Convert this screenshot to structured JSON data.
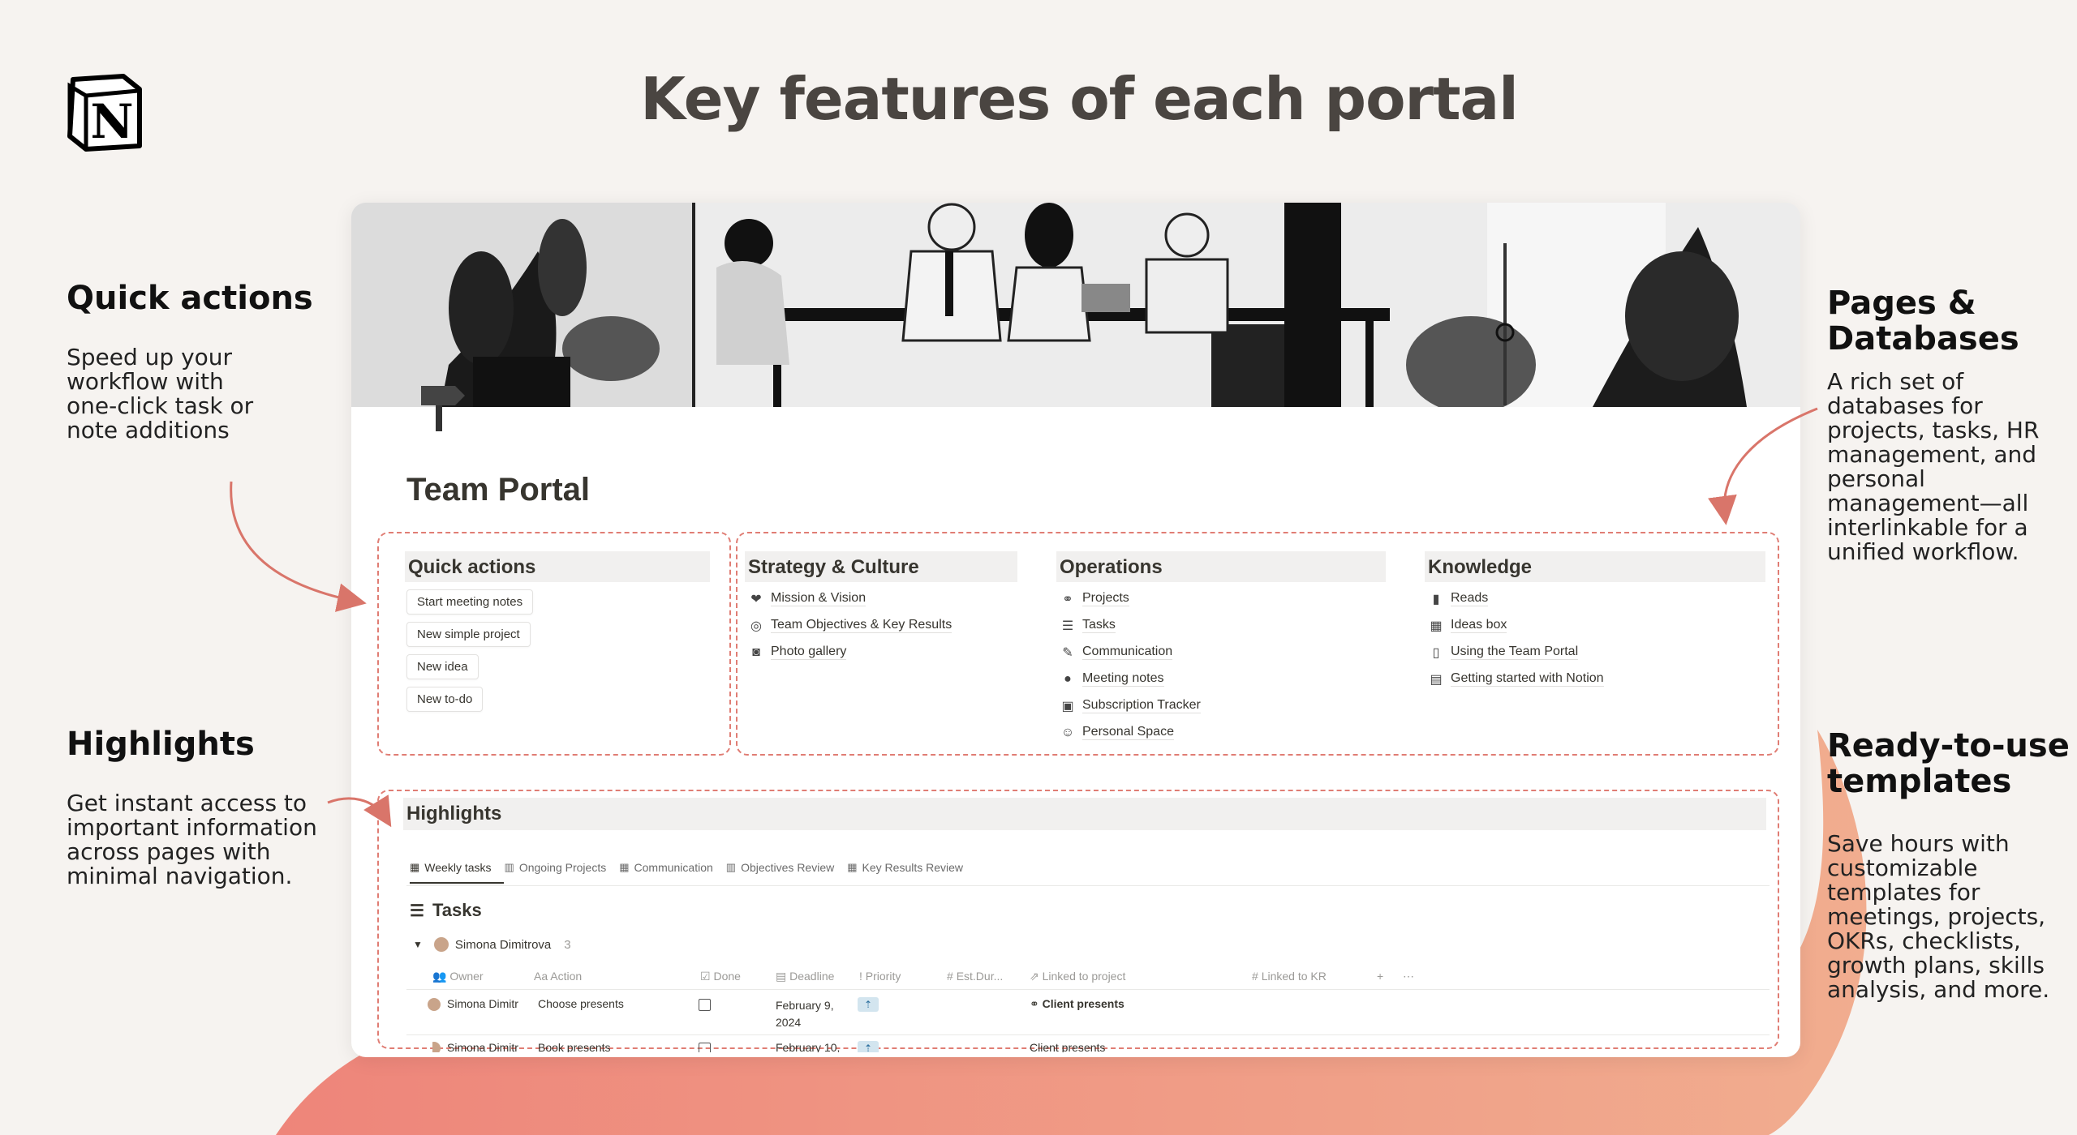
{
  "title": "Key features of each portal",
  "left": {
    "quick_actions": {
      "heading": "Quick actions",
      "text": [
        "Speed up your",
        "workflow with",
        "one-click task or",
        "note additions"
      ]
    },
    "highlights": {
      "heading": "Highlights",
      "text": [
        "Get instant access to",
        "important information",
        "across pages with",
        "minimal navigation."
      ]
    }
  },
  "right": {
    "pages": {
      "heading": [
        "Pages &",
        "Databases"
      ],
      "text": [
        "A rich set of",
        "databases for",
        "projects, tasks, HR",
        "management, and",
        "personal",
        "management—all",
        "interlinkable for a",
        "unified workflow."
      ]
    },
    "templates": {
      "heading": [
        "Ready-to-use",
        "templates"
      ],
      "text": [
        "Save hours with",
        "customizable",
        "templates for",
        "meetings, projects,",
        "OKRs, checklists,",
        "growth plans, skills",
        "analysis, and more."
      ]
    }
  },
  "portal": {
    "title": "Team Portal",
    "quick_actions": {
      "heading": "Quick actions",
      "buttons": [
        "Start meeting notes",
        "New simple project",
        "New idea",
        "New to-do"
      ]
    },
    "strategy": {
      "heading": "Strategy & Culture",
      "items": [
        "Mission & Vision",
        "Team Objectives & Key Results",
        "Photo gallery"
      ]
    },
    "operations": {
      "heading": "Operations",
      "items": [
        "Projects",
        "Tasks",
        "Communication",
        "Meeting notes",
        "Subscription Tracker",
        "Personal Space"
      ]
    },
    "knowledge": {
      "heading": "Knowledge",
      "items": [
        "Reads",
        "Ideas box",
        "Using the Team Portal",
        "Getting started with Notion"
      ]
    },
    "highlights": {
      "heading": "Highlights",
      "tabs": [
        "Weekly tasks",
        "Ongoing Projects",
        "Communication",
        "Objectives Review",
        "Key Results Review"
      ],
      "tasks_title": "Tasks",
      "group": {
        "name": "Simona Dimitrova",
        "count": "3"
      },
      "columns": [
        "Owner",
        "Action",
        "Done",
        "Deadline",
        "Priority",
        "Est.Dur...",
        "Linked to project",
        "Linked to KR"
      ],
      "rows": [
        {
          "owner": "Simona Dimitr",
          "action": "Choose presents",
          "deadline_1": "February 9,",
          "deadline_2": "2024",
          "project": "Client presents"
        },
        {
          "owner": "Simona Dimitr",
          "action": "Book presents",
          "deadline_1": "February 10,",
          "project": "Client presents"
        }
      ]
    }
  },
  "colors": {
    "accent": "#e07d74",
    "blob": "#ef8c7e",
    "background": "#f6f3f0"
  }
}
